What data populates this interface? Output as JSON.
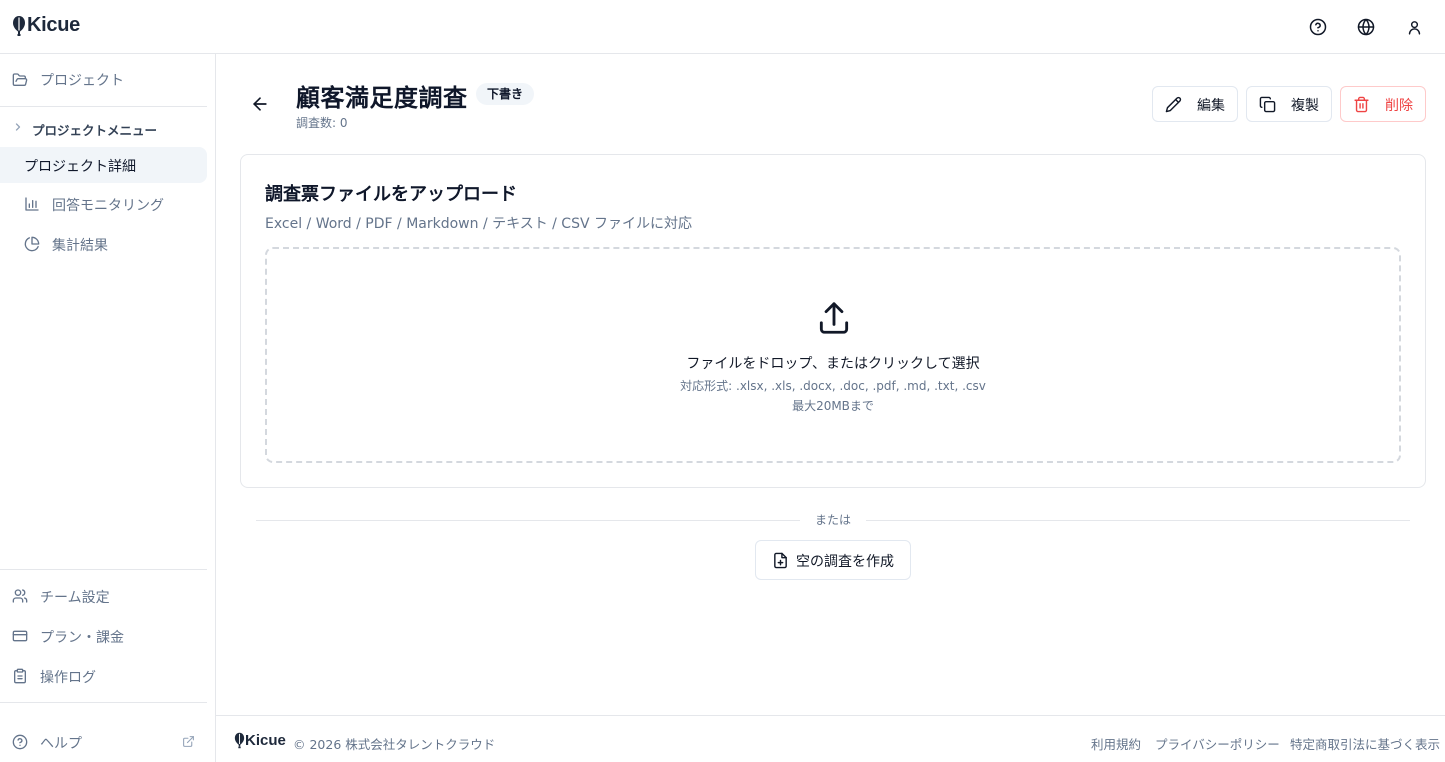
{
  "app": {
    "logo_text": "Kicue"
  },
  "header": {
    "icons": [
      "help-circle-icon",
      "globe-icon",
      "user-icon"
    ]
  },
  "sidebar": {
    "projects_label": "プロジェクト",
    "group_label": "プロジェクトメニュー",
    "items": [
      {
        "label": "プロジェクト詳細",
        "active": true
      },
      {
        "label": "回答モニタリング",
        "icon": "bar-chart-icon"
      },
      {
        "label": "集計結果",
        "icon": "pie-chart-icon"
      }
    ],
    "bottom": [
      {
        "label": "チーム設定",
        "icon": "users-icon"
      },
      {
        "label": "プラン・課金",
        "icon": "credit-card-icon"
      },
      {
        "label": "操作ログ",
        "icon": "clipboard-icon"
      }
    ],
    "help_label": "ヘルプ"
  },
  "page": {
    "title": "顧客満足度調査",
    "status_badge": "下書き",
    "survey_count": "調査数: 0",
    "actions": {
      "edit": "編集",
      "duplicate": "複製",
      "delete": "削除"
    }
  },
  "upload": {
    "title": "調査票ファイルをアップロード",
    "subtitle": "Excel / Word / PDF / Markdown / テキスト / CSV ファイルに対応",
    "drop_text": "ファイルをドロップ、またはクリックして選択",
    "formats": "対応形式: .xlsx, .xls, .docx, .doc, .pdf, .md, .txt, .csv",
    "max_size": "最大20MBまで"
  },
  "alt": {
    "or_text": "または",
    "blank_button": "空の調査を作成"
  },
  "footer": {
    "logo_text": "Kicue",
    "copyright": "© 2026 株式会社タレントクラウド",
    "links": [
      "利用規約",
      "プライバシーポリシー",
      "特定商取引法に基づく表示"
    ]
  },
  "colors": {
    "danger": "#ef4444",
    "muted": "#64748b",
    "border": "#e5e7eb"
  }
}
